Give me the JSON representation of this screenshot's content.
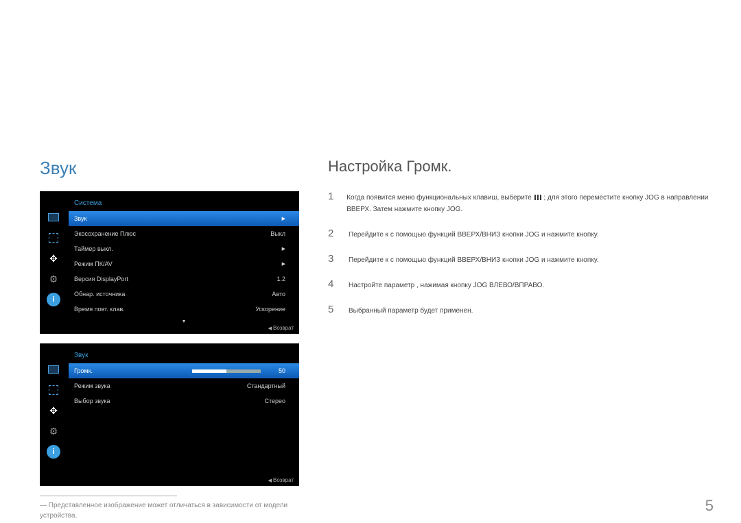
{
  "chapter_title": "Звук",
  "section_title": "Настройка Громк.",
  "osd1": {
    "title": "Система",
    "rows": [
      {
        "label": "Звук",
        "value": "",
        "arrow": true,
        "selected": true
      },
      {
        "label": "Экосохранение Плюс",
        "value": "Выкл",
        "arrow": false
      },
      {
        "label": "Таймер выкл.",
        "value": "",
        "arrow": true
      },
      {
        "label": "Режим ПК/AV",
        "value": "",
        "arrow": true
      },
      {
        "label": "Версия DisplayPort",
        "value": "1.2",
        "arrow": false
      },
      {
        "label": "Обнар. источника",
        "value": "Авто",
        "arrow": false
      },
      {
        "label": "Время повт. клав.",
        "value": "Ускорение",
        "arrow": false
      }
    ],
    "scroll_hint": "▾",
    "footer": "Возврат"
  },
  "osd2": {
    "title": "Звук",
    "rows": [
      {
        "label": "Громк.",
        "slider": 50,
        "selected": true
      },
      {
        "label": "Режим звука",
        "value": "Стандартный"
      },
      {
        "label": "Выбор звука",
        "value": "Стерео"
      }
    ],
    "footer": "Возврат"
  },
  "footnote": "― Представленное изображение может отличаться в зависимости от модели устройства.",
  "steps": [
    "Когда появится меню функциональных клавиш, выберите ⬚ ; для этого переместите кнопку JOG в направлении ВВЕРХ. Затем нажмите кнопку JOG.",
    "Перейдите к   с помощью функций ВВЕРХ/ВНИЗ кнопки JOG и нажмите кнопку.",
    "Перейдите к           с помощью функций ВВЕРХ/ВНИЗ кнопки JOG и нажмите кнопку.",
    "Настройте параметр           , нажимая кнопку JOG ВЛЕВО/ВПРАВО.",
    "Выбранный параметр будет применен."
  ],
  "page_number": "5"
}
